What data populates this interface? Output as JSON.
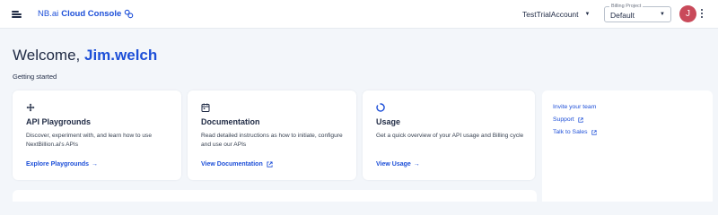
{
  "header": {
    "brand_prefix": "NB.ai",
    "brand_name": "Cloud Console",
    "account_name": "TestTrialAccount",
    "billing_project_label": "Billing Project",
    "billing_project_value": "Default",
    "avatar_initial": "J",
    "icons": [
      "menu-icon",
      "link-icon",
      "caret-down-icon",
      "kebab-icon"
    ]
  },
  "main": {
    "welcome_prefix": "Welcome, ",
    "username": "Jim.welch",
    "subtitle": "Getting started",
    "cards": [
      {
        "title": "API Playgrounds",
        "description": "Discover, experiment with, and learn how to use NextBillion.ai's APIs",
        "action": "Explore Playgrounds",
        "icon": "move-icon"
      },
      {
        "title": "Documentation",
        "description": "Read detailed instructions as how to initiate, configure and use our APIs",
        "action": "View Documentation",
        "icon": "calendar-doc-icon"
      },
      {
        "title": "Usage",
        "description": "Get a quick overview of your API usage and Billing cycle",
        "action": "View Usage",
        "icon": "spinner-icon"
      }
    ],
    "side_links": [
      "Invite your team",
      "Support",
      "Talk to Sales"
    ]
  },
  "colors": {
    "accent": "#1d4fd8",
    "text": "#1f2a44",
    "background": "#f3f6fa",
    "avatar": "#c94a5a"
  }
}
